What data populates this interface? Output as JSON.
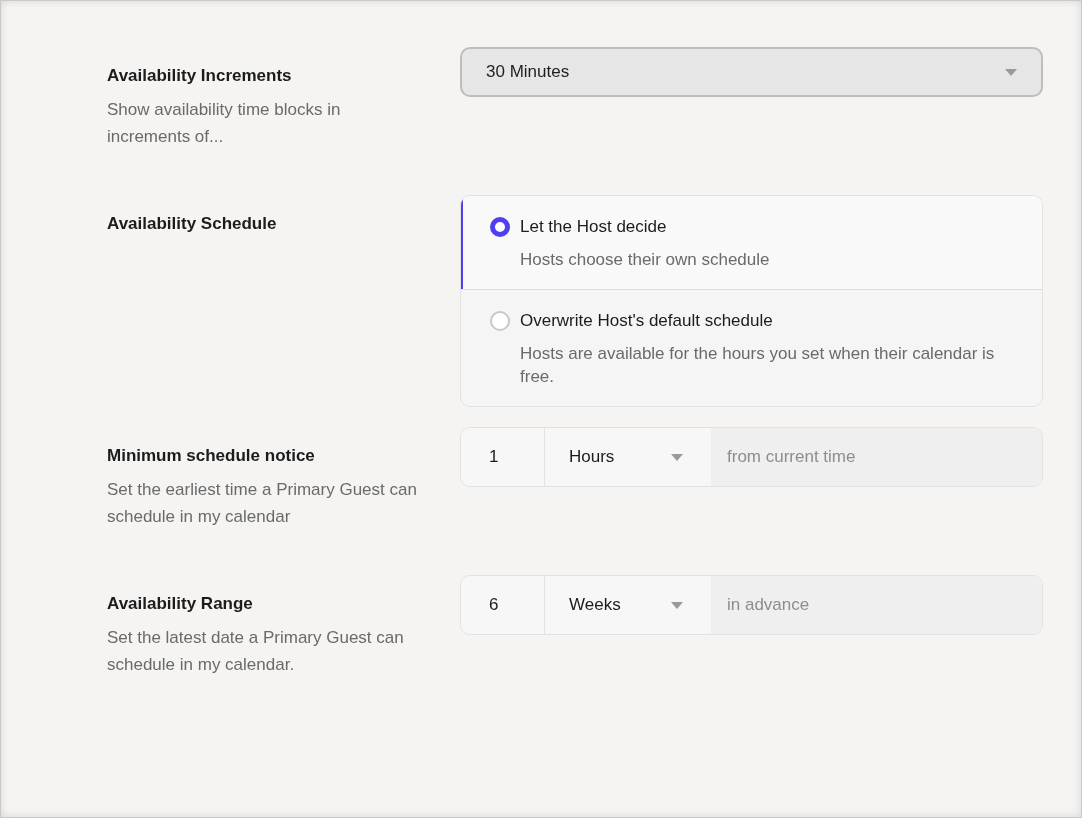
{
  "settings": [
    {
      "kind": "select",
      "label": "Availability Increments",
      "description": "Show availability time blocks in increments of...",
      "value": "30 Minutes"
    },
    {
      "kind": "radio",
      "label": "Availability Schedule",
      "options": [
        {
          "title": "Let the Host decide",
          "description": "Hosts choose their own schedule",
          "selected": true
        },
        {
          "title": "Overwrite Host's default schedule",
          "description": "Hosts are available for the hours you set when their calendar is free.",
          "selected": false
        }
      ]
    },
    {
      "kind": "duration",
      "label": "Minimum schedule notice",
      "description": "Set the earliest time a Primary Guest can schedule in my calendar",
      "amount": "1",
      "unit": "Hours",
      "suffix": "from current time"
    },
    {
      "kind": "duration",
      "label": "Availability Range",
      "description": "Set the latest date a Primary Guest can schedule in my calendar.",
      "amount": "6",
      "unit": "Weeks",
      "suffix": "in advance"
    }
  ]
}
